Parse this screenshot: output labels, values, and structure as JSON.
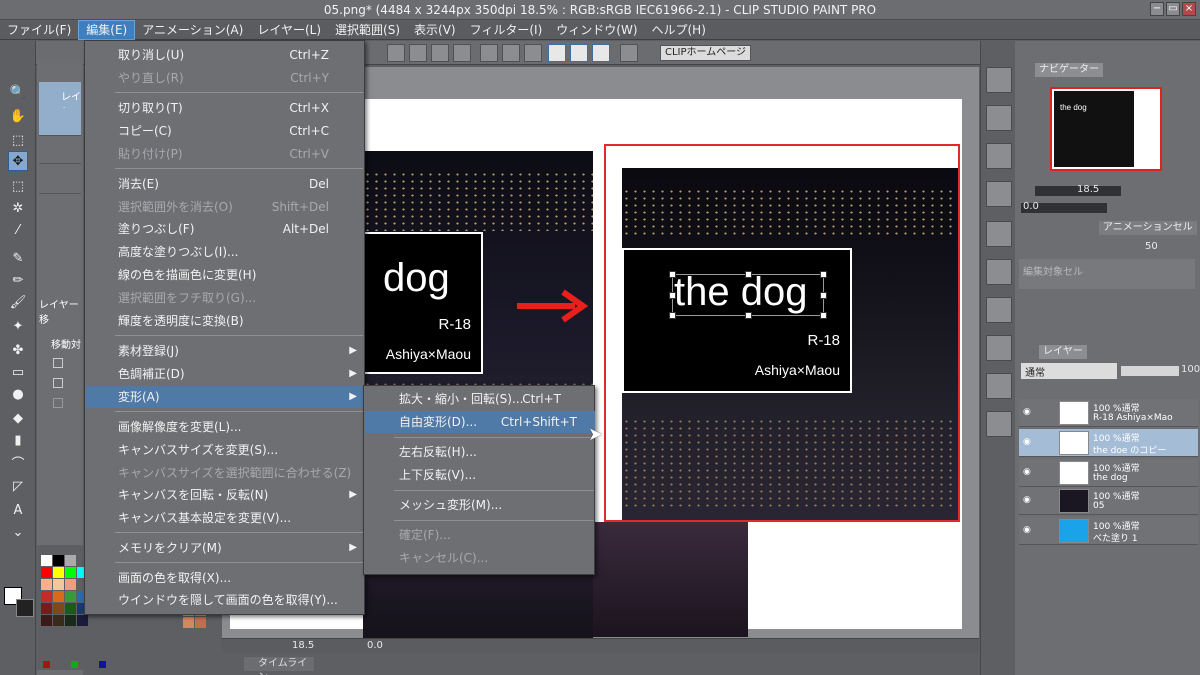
{
  "window": {
    "title": "05.png* (4484 x 3244px 350dpi 18.5% : RGB:sRGB IEC61966-2.1) - CLIP STUDIO PAINT PRO",
    "minimize": "−",
    "maximize": "▭",
    "close": "×"
  },
  "menubar": {
    "items": [
      "ファイル(F)",
      "編集(E)",
      "アニメーション(A)",
      "レイヤー(L)",
      "選択範囲(S)",
      "表示(V)",
      "フィルター(I)",
      "ウィンドウ(W)",
      "ヘルプ(H)"
    ]
  },
  "toolbar": {
    "clip_home": "CLIPホームページ"
  },
  "edit_menu": {
    "items": [
      {
        "label": "取り消し(U)",
        "shortcut": "Ctrl+Z",
        "disabled": false
      },
      {
        "label": "やり直し(R)",
        "shortcut": "Ctrl+Y",
        "disabled": true
      },
      {
        "label": "切り取り(T)",
        "shortcut": "Ctrl+X",
        "disabled": false
      },
      {
        "label": "コピー(C)",
        "shortcut": "Ctrl+C",
        "disabled": false
      },
      {
        "label": "貼り付け(P)",
        "shortcut": "Ctrl+V",
        "disabled": true
      },
      {
        "label": "消去(E)",
        "shortcut": "Del",
        "disabled": false
      },
      {
        "label": "選択範囲外を消去(O)",
        "shortcut": "Shift+Del",
        "disabled": true
      },
      {
        "label": "塗りつぶし(F)",
        "shortcut": "Alt+Del",
        "disabled": false
      },
      {
        "label": "高度な塗りつぶし(I)...",
        "shortcut": "",
        "disabled": false
      },
      {
        "label": "線の色を描画色に変更(H)",
        "shortcut": "",
        "disabled": false
      },
      {
        "label": "選択範囲をフチ取り(G)...",
        "shortcut": "",
        "disabled": true
      },
      {
        "label": "輝度を透明度に変換(B)",
        "shortcut": "",
        "disabled": false
      },
      {
        "label": "素材登録(J)",
        "shortcut": "",
        "disabled": false
      },
      {
        "label": "色調補正(D)",
        "shortcut": "",
        "disabled": false
      },
      {
        "label": "変形(A)",
        "shortcut": "",
        "disabled": false
      },
      {
        "label": "画像解像度を変更(L)...",
        "shortcut": "",
        "disabled": false
      },
      {
        "label": "キャンバスサイズを変更(S)...",
        "shortcut": "",
        "disabled": false
      },
      {
        "label": "キャンバスサイズを選択範囲に合わせる(Z)",
        "shortcut": "",
        "disabled": true
      },
      {
        "label": "キャンバスを回転・反転(N)",
        "shortcut": "",
        "disabled": false
      },
      {
        "label": "キャンバス基本設定を変更(V)...",
        "shortcut": "",
        "disabled": false
      },
      {
        "label": "メモリをクリア(M)",
        "shortcut": "",
        "disabled": false
      },
      {
        "label": "画面の色を取得(X)...",
        "shortcut": "",
        "disabled": false
      },
      {
        "label": "ウインドウを隠して画面の色を取得(Y)...",
        "shortcut": "",
        "disabled": false
      }
    ]
  },
  "transform_submenu": {
    "items": [
      {
        "label": "拡大・縮小・回転(S)...",
        "shortcut": "Ctrl+T",
        "disabled": false
      },
      {
        "label": "自由変形(D)...",
        "shortcut": "Ctrl+Shift+T",
        "disabled": false
      },
      {
        "label": "左右反転(H)...",
        "shortcut": "",
        "disabled": false
      },
      {
        "label": "上下反転(V)...",
        "shortcut": "",
        "disabled": false
      },
      {
        "label": "メッシュ変形(M)...",
        "shortcut": "",
        "disabled": false
      },
      {
        "label": "確定(F)...",
        "shortcut": "",
        "disabled": true
      },
      {
        "label": "キャンセル(C)...",
        "shortcut": "",
        "disabled": true
      }
    ]
  },
  "canvas": {
    "left_card": {
      "title": "dog",
      "rating": "R-18",
      "author": "Ashiya×Maou"
    },
    "right_card": {
      "title": "the dog",
      "rating": "R-18",
      "author": "Ashiya×Maou"
    }
  },
  "subpanel": {
    "layer_label": "レイヤー",
    "layer_move": "レイヤー移",
    "move_label": "移動対"
  },
  "navigator": {
    "tab": "ナビゲーター",
    "zoom": "18.5",
    "rotate": "0.0",
    "thumb_text": "the dog"
  },
  "animation_cel": {
    "tab": "アニメーションセル",
    "target": "編集対象セル",
    "value": "50"
  },
  "layer_panel": {
    "tab": "レイヤー",
    "blend_mode": "通常",
    "opacity": "100",
    "layers": [
      {
        "line1": "100 %通常",
        "line2": "R-18 Ashiya×Mao"
      },
      {
        "line1": "100 %通常",
        "line2": "the doe のコピー"
      },
      {
        "line1": "100 %通常",
        "line2": "the dog"
      },
      {
        "line1": "100 %通常",
        "line2": "05"
      },
      {
        "line1": "100 %通常",
        "line2": "べた塗り 1"
      }
    ]
  },
  "status": {
    "zoom": "18.5",
    "rotate": "0.0",
    "timeline": "タイムライン"
  },
  "colors": {
    "accent": "#4f79a6",
    "frame_red": "#e22a2a",
    "arrow_red": "#e8201c"
  }
}
